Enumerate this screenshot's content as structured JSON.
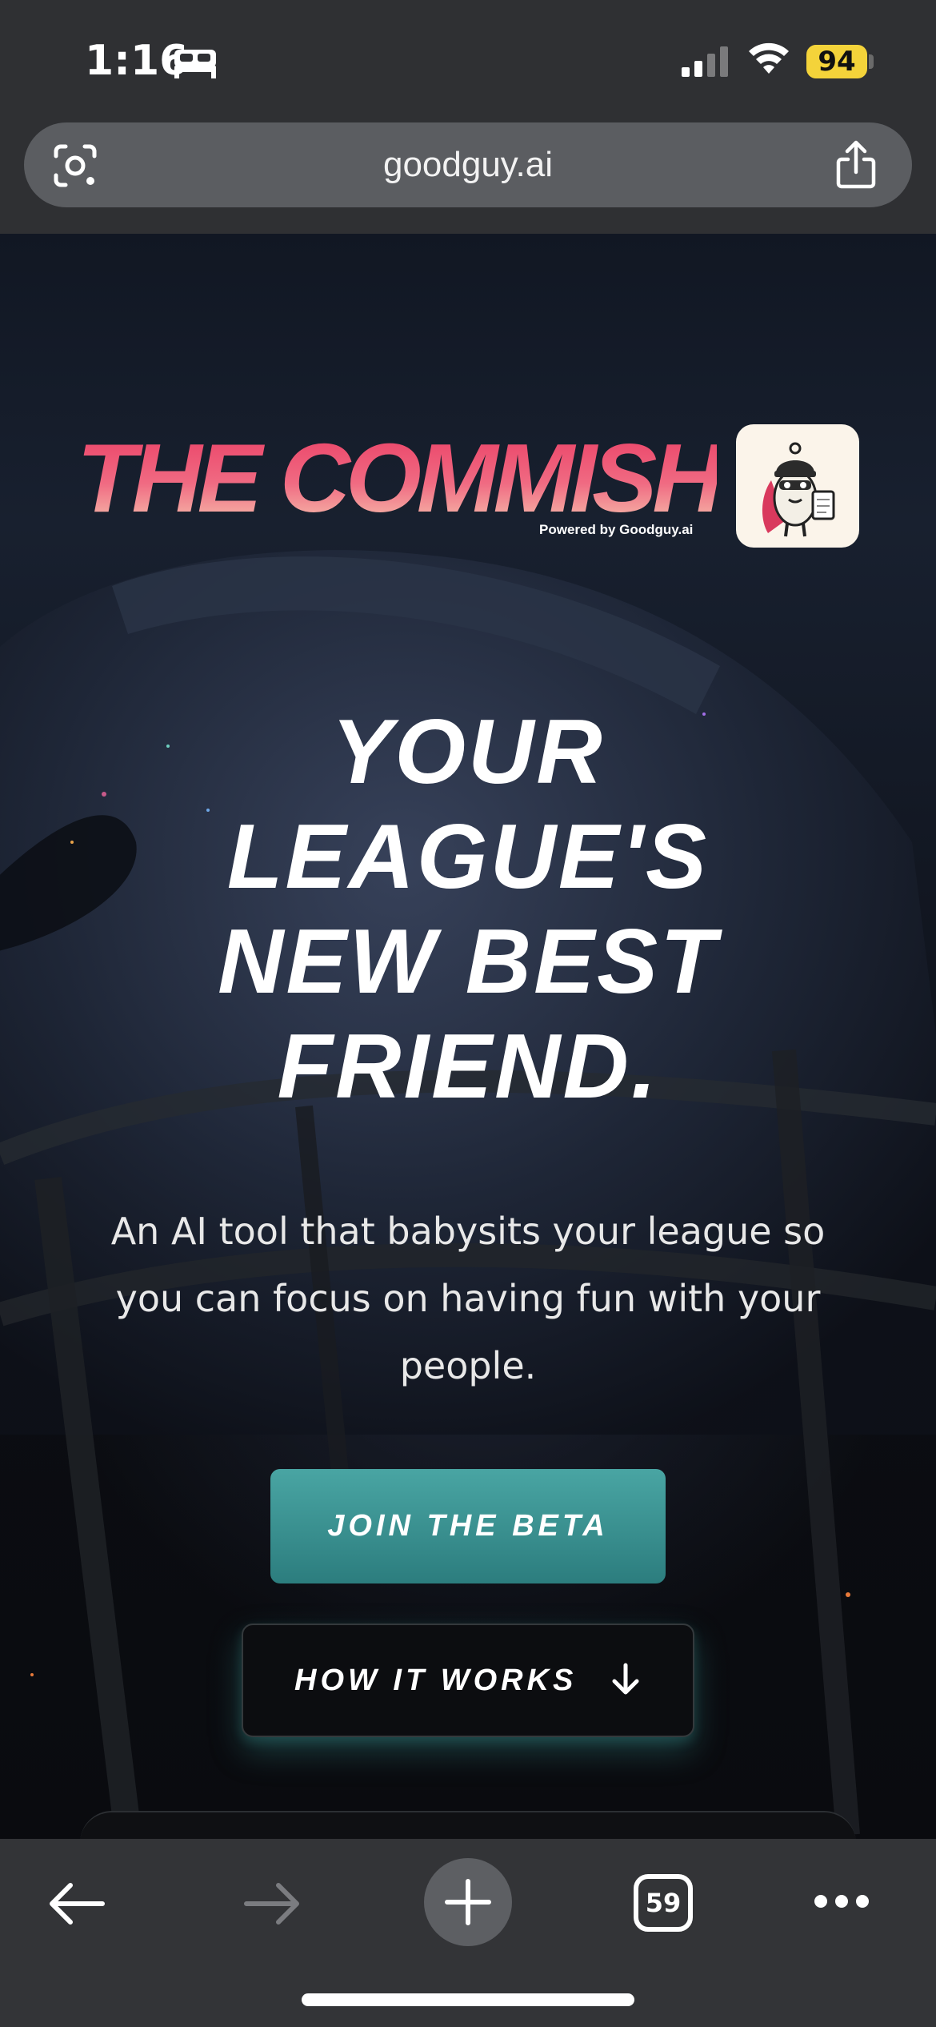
{
  "status_bar": {
    "time": "1:16",
    "focus_icon": "bed-icon",
    "battery_level": "94",
    "battery_color": "#f4d33a"
  },
  "browser": {
    "url": "goodguy.ai",
    "tab_count": "59"
  },
  "hero": {
    "logo_text": "THE COMMISH",
    "logo_tagline": "Powered by Goodguy.ai",
    "headline_lines": [
      "YOUR",
      "LEAGUE'S",
      "NEW BEST",
      "FRIEND."
    ],
    "subtext": "An AI tool that babysits your league so you can focus on having fun with your people.",
    "primary_cta": "JOIN THE BETA",
    "secondary_cta": "HOW IT WORKS",
    "colors": {
      "brand_pink": "#ec4d6f",
      "cta_teal": "#3a8f8f"
    }
  }
}
